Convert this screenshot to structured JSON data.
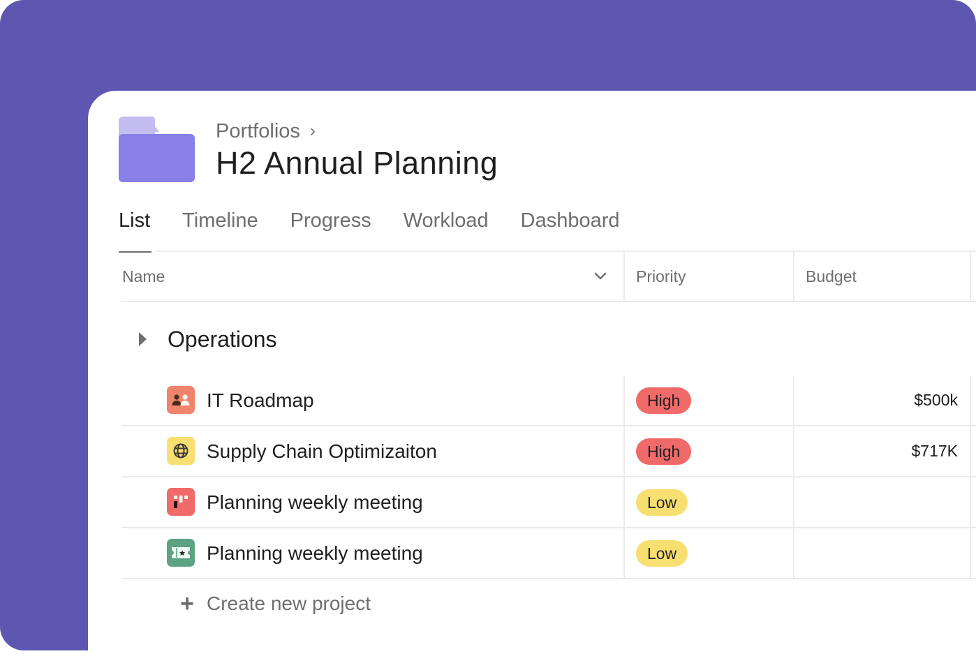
{
  "colors": {
    "background_panel": "#5e57b2",
    "folder_light": "#c3bdf2",
    "folder_dark": "#8880e6",
    "high": "#f06a6a",
    "low": "#f8df72"
  },
  "breadcrumb": {
    "parent": "Portfolios",
    "separator_icon": "chevron-right-icon"
  },
  "page": {
    "title": "H2 Annual Planning",
    "icon": "folder-icon"
  },
  "tabs": [
    {
      "label": "List",
      "active": true
    },
    {
      "label": "Timeline",
      "active": false
    },
    {
      "label": "Progress",
      "active": false
    },
    {
      "label": "Workload",
      "active": false
    },
    {
      "label": "Dashboard",
      "active": false
    }
  ],
  "table": {
    "columns": [
      {
        "label": "Name",
        "icon": "chevron-down-icon"
      },
      {
        "label": "Priority"
      },
      {
        "label": "Budget"
      }
    ],
    "section": {
      "label": "Operations",
      "icon": "triangle-right-icon"
    },
    "rows": [
      {
        "name": "IT Roadmap",
        "icon": "people-icon",
        "icon_color": "#f0836b",
        "priority": "High",
        "priority_color": "#f06a6a",
        "budget": "$500k"
      },
      {
        "name": "Supply Chain Optimizaiton",
        "icon": "globe-icon",
        "icon_color": "#f8df72",
        "priority": "High",
        "priority_color": "#f06a6a",
        "budget": "$717K"
      },
      {
        "name": "Planning weekly meeting",
        "icon": "board-icon",
        "icon_color": "#f06a6a",
        "priority": "Low",
        "priority_color": "#f8df72",
        "budget": ""
      },
      {
        "name": "Planning weekly meeting",
        "icon": "ticket-icon",
        "icon_color": "#5da283",
        "priority": "Low",
        "priority_color": "#f8df72",
        "budget": ""
      }
    ],
    "create_label": "Create new project",
    "create_icon": "plus-icon"
  }
}
